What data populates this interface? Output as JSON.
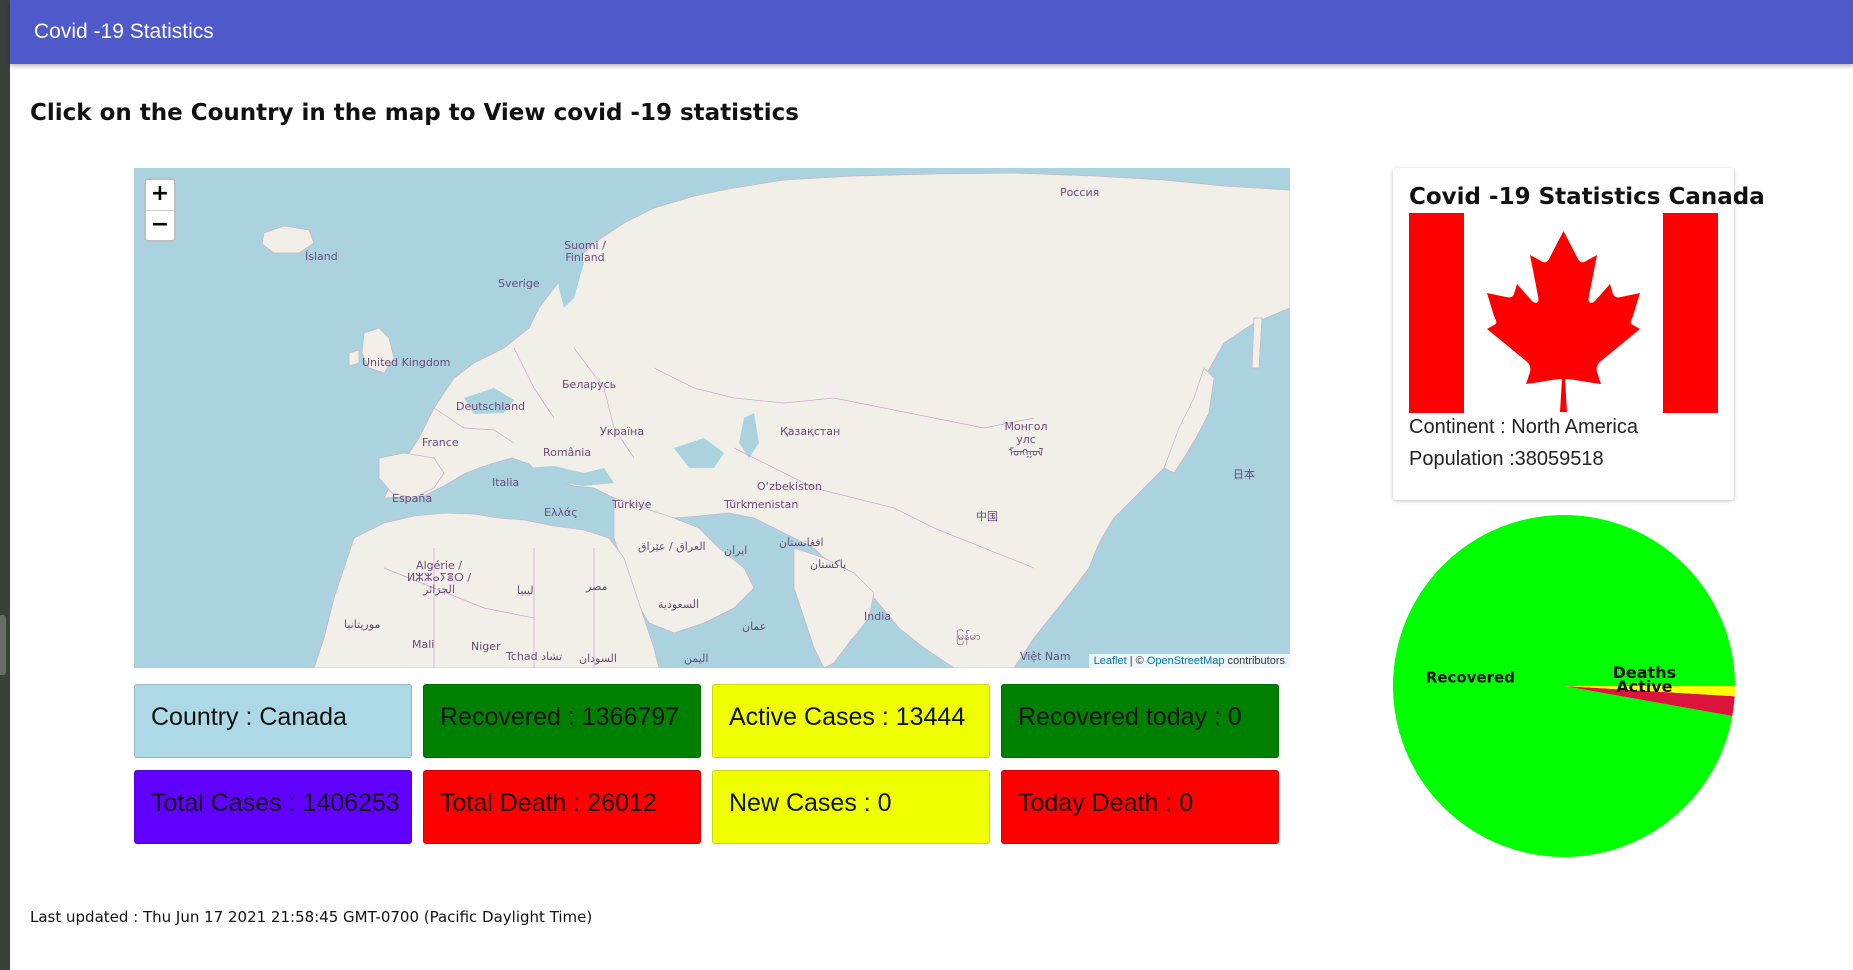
{
  "app": {
    "title": "Covid -19 Statistics"
  },
  "instruction": "Click on the Country in the map to View covid -19 statistics",
  "map": {
    "zoom_in": "+",
    "zoom_out": "−",
    "attribution": {
      "leaflet": "Leaflet",
      "sep": " | © ",
      "osm": "OpenStreetMap",
      "suffix": " contributors"
    },
    "labels": {
      "russia": "Россия",
      "iceland": "Ísland",
      "finland": "Suomi / Finland",
      "sweden": "Sverige",
      "uk": "United Kingdom",
      "belarus": "Беларусь",
      "germany": "Deutschland",
      "ukraine": "Україна",
      "kazakhstan": "Қазақстан",
      "mongolia": "Монгол улс ᠮᠤᠩᠭᠤᠯ",
      "france": "France",
      "romania": "România",
      "italy": "Italia",
      "uzbekistan": "O‘zbekiston",
      "japan": "日本",
      "spain": "España",
      "greece": "Ελλάς",
      "turkey": "Türkiye",
      "turkmenistan": "Türkmenistan",
      "china": "中国",
      "iraq": "العراق / عێراق",
      "iran": "ایران",
      "afghanistan": "افغانستان",
      "algeria": "Algérie / ⵍⵣⵣⴰⵢⴻⵔ / الجزائر",
      "pakistan": "پاکستان",
      "libya": "ليبيا",
      "egypt": "مصر",
      "saudi": "السعودية",
      "india": "India",
      "mauritania": "موريتانيا",
      "oman": "عمان",
      "mali": "Mali",
      "niger": "Niger",
      "chad": "Tchad تشاد",
      "sudan": "السودان",
      "yemen": "اليمن",
      "myanmar": "မြန်မာ",
      "vietnam": "Việt Nam"
    }
  },
  "stats": {
    "country": "Country : Canada",
    "recovered": "Recovered : 1366797",
    "active": "Active Cases : 13444",
    "recovered_today": "Recovered today : 0",
    "total_cases": "Total Cases : 1406253",
    "total_death": "Total Death : 26012",
    "new_cases": "New Cases : 0",
    "today_death": "Today Death : 0"
  },
  "colors": {
    "light_blue": "#add8e6",
    "green": "#008000",
    "yellow": "#f0ff00",
    "purple": "#6000ff",
    "red": "#ff0000",
    "pie_green": "#00ff00",
    "pie_red": "#dc143c",
    "pie_yellow": "#ffff00"
  },
  "card": {
    "title": "Covid -19 Statistics Canada",
    "continent": "Continent : North America",
    "population": "Population :38059518",
    "flag_icon": "canada-flag-icon"
  },
  "chart_data": {
    "type": "pie",
    "labels": [
      "Recovered",
      "Deaths",
      "Active"
    ],
    "values": [
      1366797,
      26012,
      13444
    ],
    "colors": [
      "#00ff00",
      "#dc143c",
      "#ffff00"
    ]
  },
  "footer": "Last updated : Thu Jun 17 2021 21:58:45 GMT-0700 (Pacific Daylight Time)"
}
